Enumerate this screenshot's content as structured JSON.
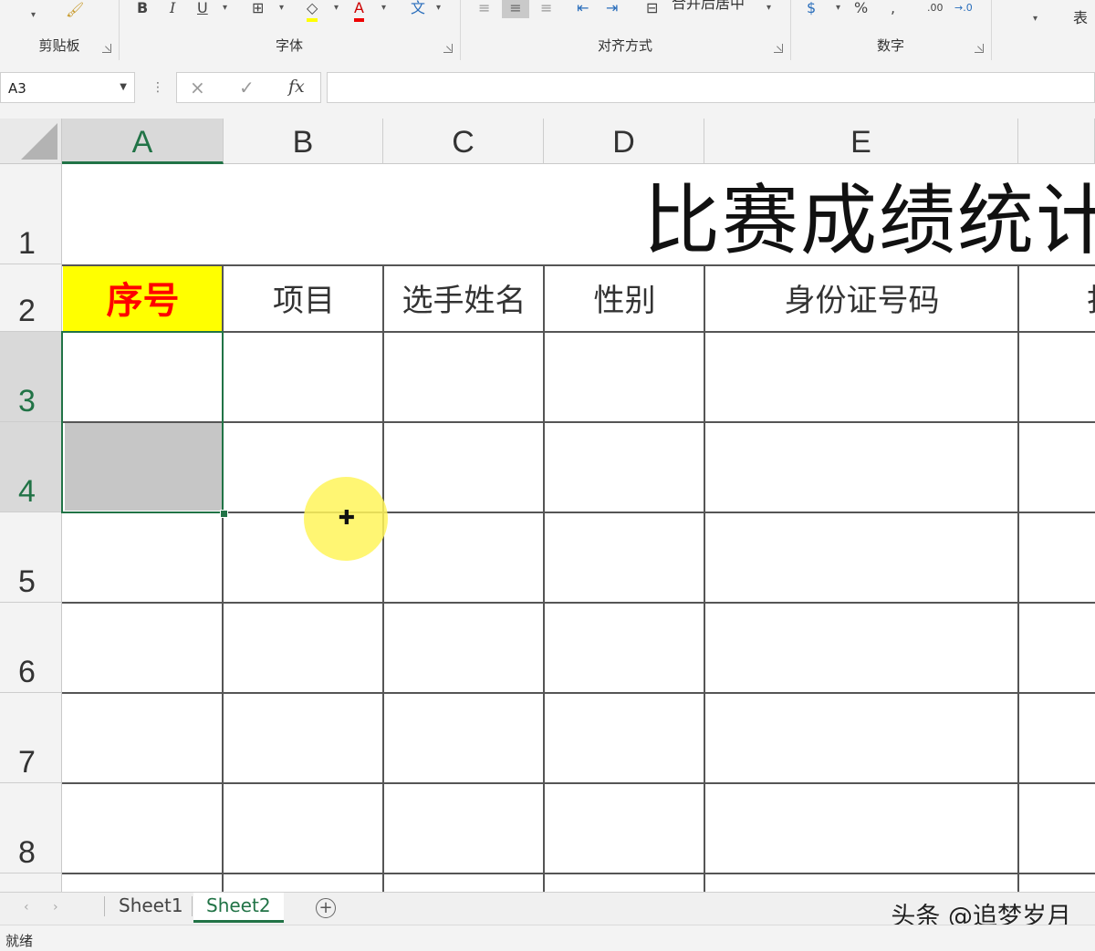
{
  "ribbon": {
    "groups": [
      {
        "name": "剪贴板"
      },
      {
        "name": "字体"
      },
      {
        "name": "对齐方式"
      },
      {
        "name": "数字"
      }
    ],
    "merge_center_label": "合并后居中",
    "percent_symbol": "%",
    "comma_symbol": ",",
    "partial_label": "表",
    "bold": "B",
    "italic": "I",
    "underline": "U",
    "font_color_letter": "A"
  },
  "formula_bar": {
    "name_box": "A3",
    "cancel_icon": "×",
    "enter_icon": "✓",
    "fx_label": "fx",
    "formula": ""
  },
  "grid": {
    "columns": [
      "A",
      "B",
      "C",
      "D",
      "E"
    ],
    "rows": [
      "1",
      "2",
      "3",
      "4",
      "5",
      "6",
      "7",
      "8"
    ],
    "selected_column": "A",
    "selected_rows": [
      "3",
      "4"
    ],
    "title": "比赛成绩统计",
    "headers": [
      "序号",
      "项目",
      "选手姓名",
      "性别",
      "身份证号码",
      "打"
    ],
    "colors": {
      "header_fill": "#ffff00",
      "header_text": "#ff0000",
      "selection": "#217346"
    }
  },
  "sheets": {
    "tabs": [
      "Sheet1",
      "Sheet2"
    ],
    "active": "Sheet2",
    "add_icon": "+"
  },
  "watermark": "头条 @追梦岁月",
  "status": {
    "text": "就绪"
  }
}
